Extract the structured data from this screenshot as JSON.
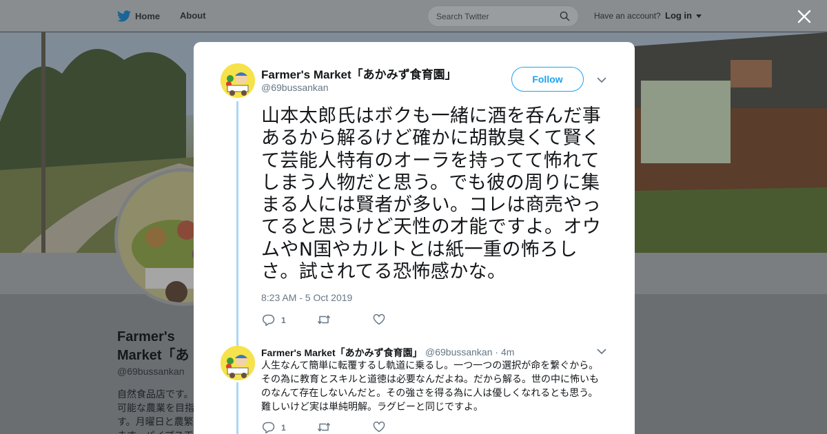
{
  "topbar": {
    "home_label": "Home",
    "about_label": "About",
    "search_placeholder": "Search Twitter",
    "account_text": "Have an account?",
    "login_label": "Log in"
  },
  "profile_background": {
    "name": "Farmer's Market「あかみず食育園」",
    "handle": "@69bussankan",
    "bio": "自然食品店です。可能な農業を目指す。月曜日と農繁ます。パイプス工"
  },
  "tweet": {
    "author_name": "Farmer's Market「あかみず食育園」",
    "author_handle": "@69bussankan",
    "follow_label": "Follow",
    "text": "山本太郎氏はボクも一緒に酒を呑んだ事あるから解るけど確かに胡散臭くて賢くて芸能人特有のオーラを持ってて怖れてしまう人物だと思う。でも彼の周りに集まる人には賢者が多い。コレは商売やってると思うけど天性の才能ですよ。オウムやN国やカルトとは紙一重の怖ろしさ。試されてる恐怖感かな。",
    "timestamp": "8:23 AM - 5 Oct 2019",
    "reply_count": "1",
    "retweet_count": "",
    "like_count": ""
  },
  "reply": {
    "author_name": "Farmer's Market「あかみず食育園」",
    "author_handle": "@69bussankan",
    "time_ago": "· 4m",
    "text": "人生なんて簡単に転覆するし軌道に乗るし。一つ一つの選択が命を繋ぐから。その為に教育とスキルと道徳は必要なんだよね。だから解る。世の中に怖いものなんて存在しないんだと。その強さを得る為に人は優しくなれるとも思う。難しいけど実は単純明解。ラグビーと同じですよ。",
    "reply_count": "1"
  },
  "colors": {
    "accent": "#1da1f2",
    "text": "#14171a",
    "muted": "#657786",
    "thread": "#a8d8f6"
  }
}
